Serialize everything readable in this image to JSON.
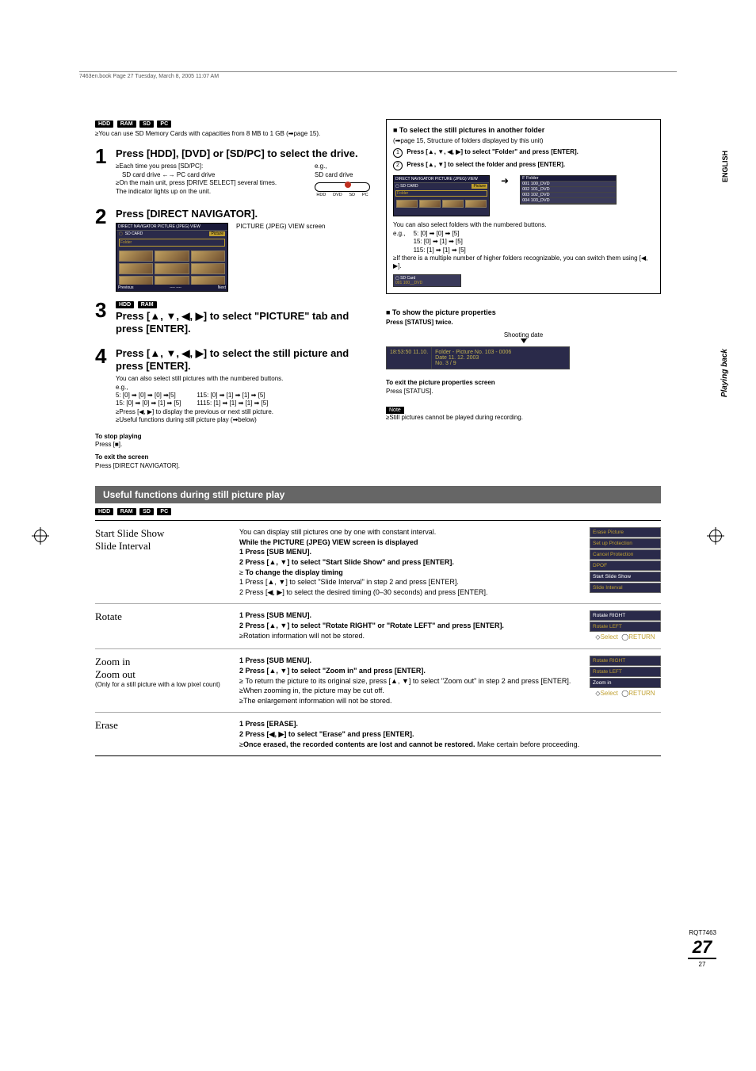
{
  "header_text": "7463en.book  Page 27  Tuesday, March 8, 2005  11:07 AM",
  "media_badges": [
    "HDD",
    "RAM",
    "SD",
    "PC"
  ],
  "intro_line": "You can use SD Memory Cards with capacities from 8 MB to 1 GB (➡page 15).",
  "steps": [
    {
      "num": "1",
      "title": "Press [HDD], [DVD] or [SD/PC] to select the drive.",
      "lines": [
        "Each time you press [SD/PC]:",
        "SD card drive ←→ PC card drive",
        "On the main unit, press [DRIVE SELECT] several times.",
        "The indicator lights up on the unit."
      ],
      "eg": "e.g.,",
      "eg2": "SD card drive",
      "ind": [
        "HDD",
        "DVD",
        "SD",
        "PC"
      ]
    },
    {
      "num": "2",
      "title": "Press [DIRECT NAVIGATOR].",
      "caption": "PICTURE (JPEG) VIEW screen"
    },
    {
      "num": "3",
      "badges": [
        "HDD",
        "RAM"
      ],
      "title": "Press [▲, ▼, ◀, ▶] to select \"PICTURE\" tab and press [ENTER]."
    },
    {
      "num": "4",
      "title": "Press [▲, ▼, ◀, ▶] to select the still picture and press [ENTER].",
      "lines": [
        "You can also select still pictures with the numbered buttons.",
        "e.g.,"
      ],
      "examples_left": [
        "5:     [0] ➡ [0] ➡ [0] ➡[5]",
        "15:   [0] ➡ [0] ➡ [1] ➡ [5]"
      ],
      "examples_right": [
        "115:   [0] ➡ [1] ➡ [1] ➡ [5]",
        "1115: [1] ➡ [1] ➡ [1] ➡ [5]"
      ],
      "after": [
        "Press [◀, ▶] to display the previous or next still picture.",
        "Useful functions during still picture play (➡below)"
      ]
    }
  ],
  "stop_h": "To stop playing",
  "stop_b": "Press [■].",
  "exit_h": "To exit the screen",
  "exit_b": "Press [DIRECT NAVIGATOR].",
  "screen": {
    "title": "DIRECT NAVIGATOR   PICTURE (JPEG) VIEW",
    "sub": "SD CARD",
    "prev": "Previous",
    "next": "Next",
    "folder": "Folder",
    "sel": "Select",
    "picture_tab": "Picture"
  },
  "right_folder": {
    "heading": "■ To select the still pictures in another folder",
    "sub": "(➡page 15, Structure of folders displayed by this unit)",
    "line1": "Press [▲, ▼, ◀, ▶] to select \"Folder\" and press [ENTER].",
    "line2": "Press [▲, ▼] to select the folder and press [ENTER].",
    "folders_hdr": "F        Folder",
    "folders": [
      "001 100_DVD",
      "002 101_DVD",
      "003 102_DVD",
      "004 103_DVD"
    ],
    "note1": "You can also select folders with the numbered buttons.",
    "eg": "e.g.,",
    "ex": [
      "5:      [0] ➡ [0] ➡ [5]",
      "15:    [0] ➡ [1] ➡ [5]",
      "115:  [1] ➡ [1] ➡ [5]"
    ],
    "note2": "If there is a multiple number of higher folders recognizable, you can switch them using [◀, ▶].",
    "icon_label": "SD Card",
    "icon_sub": "001   100__DVD"
  },
  "right_props": {
    "heading": "■ To show the picture properties",
    "sub": "Press [STATUS] twice.",
    "shoot": "Shooting date",
    "pl": "18:53:50 11.10.",
    "pr1": "Folder - Picture No.   103 - 0006",
    "pr2": "Date   11. 12. 2003",
    "pr3": "No.          3 / 9",
    "exit_h": "To exit the picture properties screen",
    "exit_b": "Press [STATUS].",
    "note_label": "Note",
    "note": "Still pictures cannot be played during recording."
  },
  "sidebar1": "ENGLISH",
  "sidebar2": "Playing back",
  "useful": {
    "title": "Useful functions during still picture play",
    "badges": [
      "HDD",
      "RAM",
      "SD",
      "PC"
    ],
    "rows": [
      {
        "name": "Start Slide Show\nSlide Interval",
        "body_pre": "You can display still pictures one by one with constant interval.",
        "body_bold": "While the PICTURE (JPEG) VIEW screen is displayed",
        "body_steps": [
          "1   Press [SUB MENU].",
          "2   Press [▲, ▼] to select \"Start Slide Show\" and press [ENTER]."
        ],
        "sub_bold": "To change the display timing",
        "sub_steps": [
          "1   Press [▲, ▼] to select \"Slide Interval\" in step 2 and press [ENTER].",
          "2   Press [◀, ▶] to select the desired timing (0–30 seconds) and press [ENTER]."
        ],
        "menu": [
          "Erase Picture",
          "Set up Protection",
          "Cancel Protection",
          "DPOF",
          "Start Slide Show",
          "Slide Interval"
        ]
      },
      {
        "name": "Rotate",
        "body_steps": [
          "1   Press [SUB MENU].",
          "2   Press [▲, ▼] to select \"Rotate RIGHT\" or \"Rotate LEFT\" and press [ENTER]."
        ],
        "after": [
          "Rotation information will not be stored."
        ],
        "menu": [
          "Rotate RIGHT",
          "Rotate LEFT"
        ],
        "nav": true
      },
      {
        "name": "Zoom in\nZoom out",
        "note": "(Only for a still picture with a low pixel count)",
        "body_steps": [
          "1   Press [SUB MENU].",
          "2   Press [▲, ▼] to select \"Zoom in\" and press [ENTER]."
        ],
        "after": [
          "To return the picture to its original size, press [▲, ▼] to select \"Zoom out\" in step 2 and press [ENTER].",
          "When zooming in, the picture may be cut off.",
          "The enlargement information will not be stored."
        ],
        "menu": [
          "Rotate RIGHT",
          "Rotate LEFT",
          "Zoom in"
        ],
        "nav": true
      },
      {
        "name": "Erase",
        "body_steps": [
          "1   Press [ERASE].",
          "2   Press [◀, ▶] to select \"Erase\" and press [ENTER]."
        ],
        "after_bold": "Once erased, the recorded contents are lost and cannot be restored.",
        "after_rest": " Make certain before proceeding."
      }
    ]
  },
  "model_code": "RQT7463",
  "page_big": "27",
  "page_small": "27"
}
